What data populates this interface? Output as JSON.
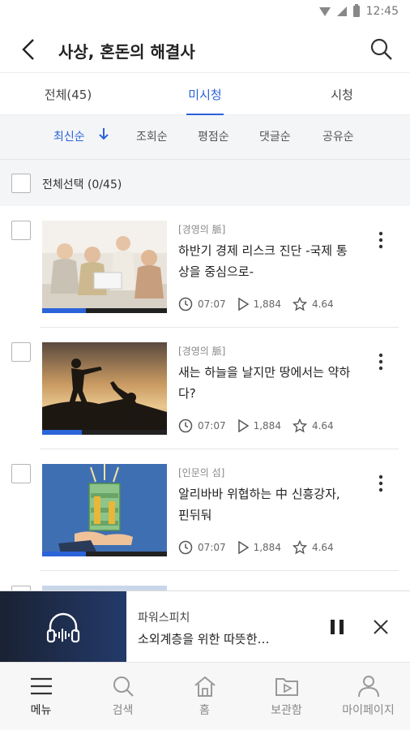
{
  "status_bar": {
    "time": "12:45"
  },
  "header": {
    "title": "사상, 혼돈의 해결사"
  },
  "tabs": [
    {
      "label": "전체(45)"
    },
    {
      "label": "미시청"
    },
    {
      "label": "시청"
    }
  ],
  "sort_options": [
    {
      "label": "최신순"
    },
    {
      "label": "조회순"
    },
    {
      "label": "평점순"
    },
    {
      "label": "댓글순"
    },
    {
      "label": "공유순"
    }
  ],
  "select_all": {
    "label": "전체선택 (0/45)"
  },
  "items": [
    {
      "category": "[경영의 脈]",
      "title": "하반기 경제 리스크 진단 -국제 통상을 중심으로-",
      "duration": "07:07",
      "views": "1,884",
      "rating": "4.64",
      "progress": 0.35
    },
    {
      "category": "[경영의 脈]",
      "title": "새는 하늘을 날지만 땅에서는 약하다?",
      "duration": "07:07",
      "views": "1,884",
      "rating": "4.64",
      "progress": 0.32
    },
    {
      "category": "[인문의 섬]",
      "title": "알리바바 위협하는 中 신흥강자, 핀뒤둬",
      "duration": "07:07",
      "views": "1,884",
      "rating": "4.64",
      "progress": 0.35
    }
  ],
  "player": {
    "title": "파워스피치",
    "subtitle": "소외계층을 위한 따뜻한…"
  },
  "bottom_nav": [
    {
      "label": "메뉴",
      "icon": "menu-icon"
    },
    {
      "label": "검색",
      "icon": "search-icon"
    },
    {
      "label": "홈",
      "icon": "home-icon"
    },
    {
      "label": "보관함",
      "icon": "folder-play-icon"
    },
    {
      "label": "마이페이지",
      "icon": "person-icon"
    }
  ],
  "colors": {
    "accent": "#2b63d9"
  }
}
